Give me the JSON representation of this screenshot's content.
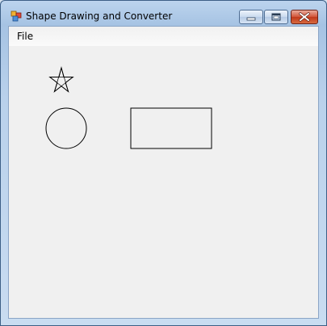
{
  "window": {
    "title": "Shape Drawing and Converter",
    "icon": "app-icon"
  },
  "caption_buttons": {
    "minimize": "minimize-icon",
    "maximize": "maximize-icon",
    "close": "close-icon"
  },
  "menu": {
    "items": [
      {
        "label": "File"
      }
    ]
  },
  "canvas": {
    "shapes": [
      {
        "type": "star",
        "points": 5
      },
      {
        "type": "circle"
      },
      {
        "type": "rectangle"
      }
    ]
  },
  "colors": {
    "client_background": "#f0f0f0",
    "shape_stroke": "#000000",
    "close_button": "#c7432a"
  }
}
